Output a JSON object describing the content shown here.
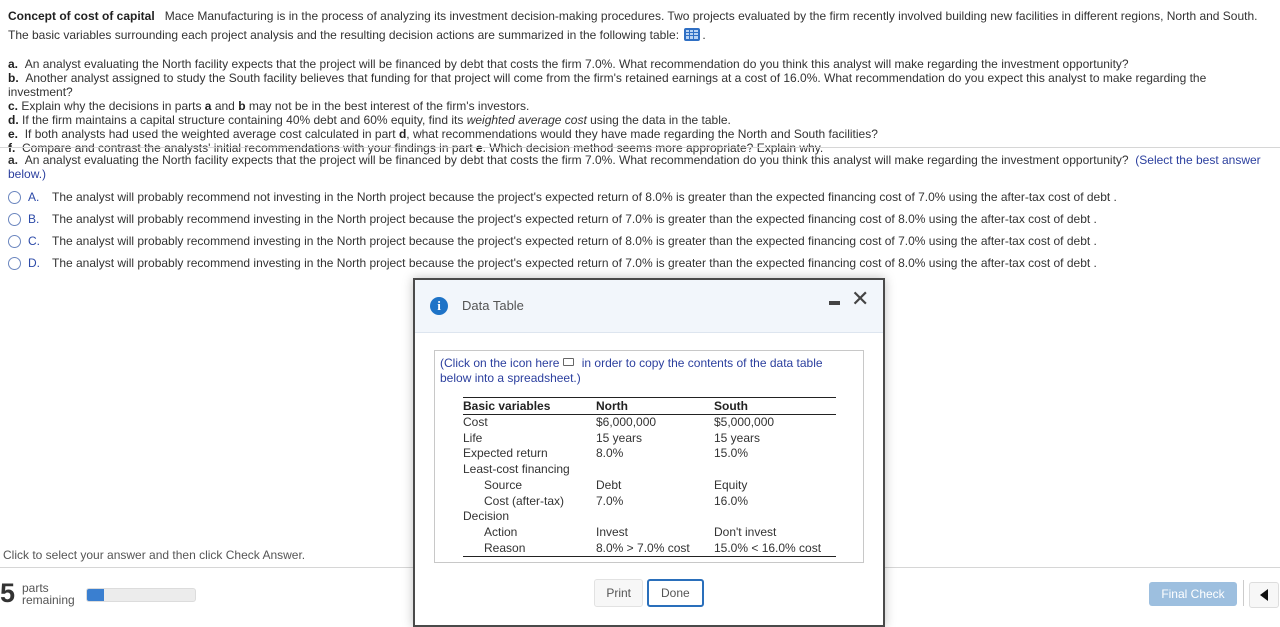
{
  "intro": {
    "title": "Concept of cost of capital",
    "text_before_icon": "Mace Manufacturing is in the process of analyzing its investment decision-making procedures.  Two projects evaluated by the firm recently involved building new facilities in different regions, North and South.  The basic variables surrounding each project analysis and the resulting decision actions are summarized in the following table:",
    "icon": "data-table-icon",
    "text_after_icon": "."
  },
  "parts": [
    {
      "letter": "a.",
      "text": "An analyst evaluating the North facility expects that the project will be financed by debt that costs the firm 7.0%. What recommendation do you think this analyst will make regarding the investment opportunity?"
    },
    {
      "letter": "b.",
      "text": "Another analyst assigned to study the South facility believes that funding for that project will come from the firm's retained earnings at a cost of 16.0%. What recommendation do you expect this analyst to make regarding the investment?"
    },
    {
      "letter": "c.",
      "pre": "Explain why the decisions in parts ",
      "b1": "a",
      "mid": " and ",
      "b2": "b",
      "post": " may not be in the best interest of the firm's investors."
    },
    {
      "letter": "d.",
      "pre": "If the firm maintains a capital structure containing 40% debt and 60% equity, find its ",
      "em": "weighted average cost",
      "post": " using the data in the table."
    },
    {
      "letter": "e.",
      "pre": "If both analysts had used the weighted average cost calculated in part ",
      "b1": "d",
      "post": ", what recommendations would they have made regarding the North and South facilities?"
    },
    {
      "letter": "f.",
      "pre": "Compare and contrast the analysts' initial recommendations with your findings in part ",
      "b1": "e",
      "post": ". Which decision method seems more appropriate? Explain why."
    }
  ],
  "question": {
    "letter": "a.",
    "text": "An analyst evaluating the North facility expects that the project will be financed by debt that costs the firm 7.0%. What recommendation do you think this analyst will make regarding the investment opportunity?",
    "hint": "(Select the best answer below.)"
  },
  "options": [
    {
      "letter": "A.",
      "text": "The analyst will probably recommend not investing in the North project because the project's expected return of 8.0% is greater than the expected financing cost of 7.0% using the after-tax cost of debt ."
    },
    {
      "letter": "B.",
      "text": "The analyst will probably recommend investing in the North project because the project's expected return of 7.0% is greater than the expected financing cost of 8.0% using the after-tax cost of debt ."
    },
    {
      "letter": "C.",
      "text": "The analyst will probably recommend investing in the North project because the project's expected return of 8.0% is greater than the expected financing cost of 7.0% using the after-tax cost of debt ."
    },
    {
      "letter": "D.",
      "text": "The analyst will probably recommend investing in the North project because the project's expected return of 7.0% is greater than the expected financing cost of 8.0% using the after-tax cost of debt ."
    }
  ],
  "status_text": "Click to select your answer and then click Check Answer.",
  "footer": {
    "parts_remaining": "5",
    "parts_label_1": "parts",
    "parts_label_2": "remaining",
    "progress_fraction": 0.16,
    "final_check_label": "Final Check",
    "prev_icon": "triangle-left-icon"
  },
  "dialog": {
    "title": "Data Table",
    "info_icon_glyph": "i",
    "close_glyph": "✕",
    "copy_note_pre": "(Click on the icon  here",
    "copy_note_post": " in order to copy the contents of the data table below into a spreadsheet.)",
    "table": {
      "headers": [
        "Basic variables",
        "North",
        "South"
      ],
      "rows": [
        {
          "label": "Cost",
          "north": "$6,000,000",
          "south": "$5,000,000",
          "indent": false
        },
        {
          "label": "Life",
          "north": "15 years",
          "south": "15 years",
          "indent": false
        },
        {
          "label": "Expected return",
          "north": "8.0%",
          "south": "15.0%",
          "indent": false
        },
        {
          "label": "Least-cost financing",
          "north": "",
          "south": "",
          "indent": false
        },
        {
          "label": "Source",
          "north": "Debt",
          "south": "Equity",
          "indent": true
        },
        {
          "label": "Cost (after-tax)",
          "north": "7.0%",
          "south": "16.0%",
          "indent": true
        },
        {
          "label": "Decision",
          "north": "",
          "south": "",
          "indent": false
        },
        {
          "label": "Action",
          "north": "Invest",
          "south": "Don't invest",
          "indent": true
        },
        {
          "label": "Reason",
          "north": "8.0% > 7.0% cost",
          "south": "15.0% < 16.0% cost",
          "indent": true
        }
      ]
    },
    "print_label": "Print",
    "done_label": "Done"
  }
}
